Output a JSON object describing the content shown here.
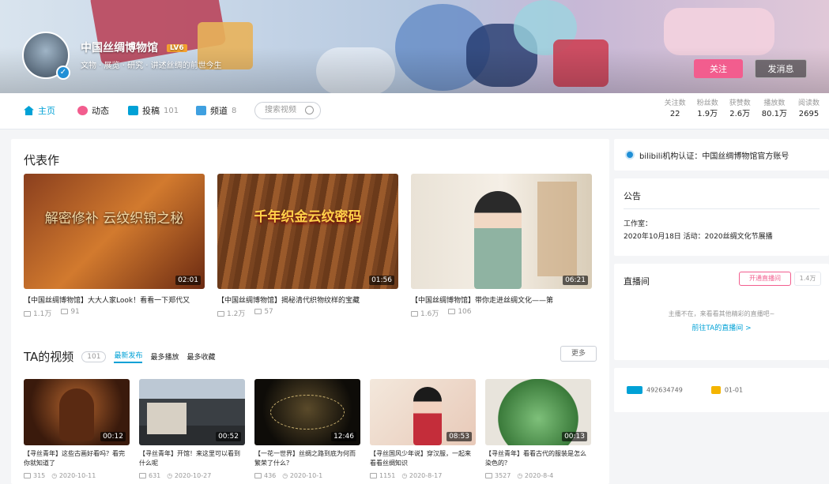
{
  "profile": {
    "name": "中国丝绸博物馆",
    "level_badge": "LV6",
    "sign": "文物 · 展览 · 研究 · 讲述丝绸的前世今生",
    "follow_label": "关注",
    "message_label": "发消息"
  },
  "nav": {
    "home": "主页",
    "dynamic": "动态",
    "upload": "投稿",
    "upload_count": "101",
    "channel": "频道",
    "channel_count": "8",
    "search_placeholder": "搜索视频"
  },
  "stats": [
    {
      "label": "关注数",
      "value": "22"
    },
    {
      "label": "粉丝数",
      "value": "1.9万"
    },
    {
      "label": "获赞数",
      "value": "2.6万"
    },
    {
      "label": "播放数",
      "value": "80.1万"
    },
    {
      "label": "阅读数",
      "value": "2695"
    }
  ],
  "masterpiece": {
    "title": "代表作",
    "items": [
      {
        "thumb_text": "解密修补 云纹织锦之秘",
        "duration": "02:01",
        "title": "【中国丝绸博物馆】大大人家Look！看看一下郑代又",
        "plays": "1.1万",
        "comments": "91"
      },
      {
        "thumb_text": "千年织金云纹密码",
        "duration": "01:56",
        "title": "【中国丝绸博物馆】揭秘清代织物纹样的宝藏",
        "plays": "1.2万",
        "comments": "57"
      },
      {
        "thumb_text": "",
        "duration": "06:21",
        "title": "【中国丝绸博物馆】带你走进丝绸文化——第",
        "plays": "1.6万",
        "comments": "106"
      }
    ]
  },
  "videos": {
    "title": "TA的视频",
    "count": "101",
    "tabs": [
      "最新发布",
      "最多播放",
      "最多收藏"
    ],
    "more_label": "更多",
    "items": [
      {
        "duration": "00:12",
        "title": "【寻丝青年】这些古画好看吗？看完你就知道了",
        "plays": "315",
        "date": "2020-10-11"
      },
      {
        "duration": "00:52",
        "title": "【寻丝青年】开馆！来这里可以看到什么呢",
        "plays": "631",
        "date": "2020-10-27"
      },
      {
        "duration": "12:46",
        "title": "【一花一世界】丝绸之路到底为何而繁荣了什么？",
        "plays": "436",
        "date": "2020-10-1"
      },
      {
        "duration": "08:53",
        "title": "【寻丝国风少年说】穿汉服，一起来看看丝绸知识",
        "plays": "1151",
        "date": "2020-8-17"
      },
      {
        "duration": "00:13",
        "title": "【寻丝青年】看看古代的服装是怎么染色的？",
        "plays": "3527",
        "date": "2020-8-4"
      }
    ]
  },
  "sidebar": {
    "verify": "bilibili机构认证：中国丝绸博物馆官方账号",
    "notice_title": "公告",
    "notice_line1": "工作室：",
    "notice_line2": "2020年10月18日 活动：2020丝绸文化节展播",
    "live_title": "直播间",
    "live_btn1": "开通直播间",
    "live_btn2": "1.4万",
    "live_empty": "主播不在，来看看其他精彩的直播吧~",
    "live_link": "前往TA的直播间 >",
    "uid": "492634749",
    "birthday": "01-01"
  },
  "colors": {
    "accent_pink": "#f25d8e",
    "accent_blue": "#00a1d6"
  }
}
